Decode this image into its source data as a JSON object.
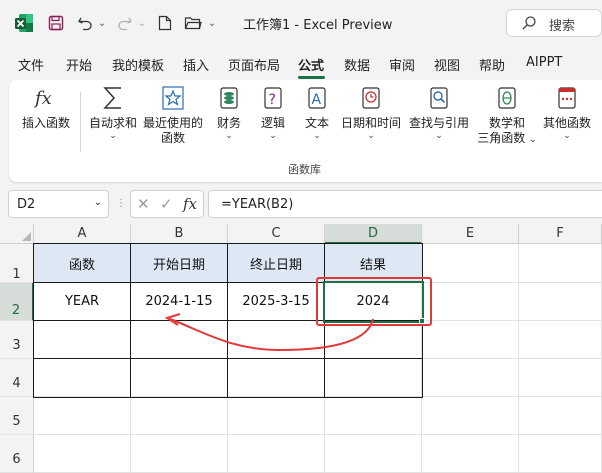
{
  "titlebar": {
    "title": "工作簿1  -  Excel Preview",
    "search_label": "搜索"
  },
  "menu": {
    "tabs": [
      "文件",
      "开始",
      "我的模板",
      "插入",
      "页面布局",
      "公式",
      "数据",
      "审阅",
      "视图",
      "帮助",
      "AIPPT"
    ],
    "active": "公式"
  },
  "ribbon": {
    "insert_function": "插入函数",
    "autosum": "自动求和",
    "recent_line1": "最近使用的",
    "recent_line2": "函数",
    "financial": "财务",
    "logical": "逻辑",
    "text": "文本",
    "datetime": "日期和时间",
    "lookup": "查找与引用",
    "math_line1": "数学和",
    "math_line2": "三角函数",
    "more": "其他函数",
    "group_label": "函数库",
    "chevron": "⌄"
  },
  "formula_bar": {
    "name_box": "D2",
    "formula": "=YEAR(B2)",
    "fx": "fx"
  },
  "sheet": {
    "columns": [
      "A",
      "B",
      "C",
      "D",
      "E",
      "F"
    ],
    "rows": [
      "1",
      "2",
      "3",
      "4",
      "5",
      "6"
    ],
    "headers": [
      "函数",
      "开始日期",
      "终止日期",
      "结果"
    ],
    "row2": [
      "YEAR",
      "2024-1-15",
      "2025-3-15",
      "2024"
    ],
    "selected_cell": "D2"
  },
  "colors": {
    "accent": "#1e7145",
    "header_fill": "#dde8f4",
    "annotation": "#e23a3a"
  }
}
